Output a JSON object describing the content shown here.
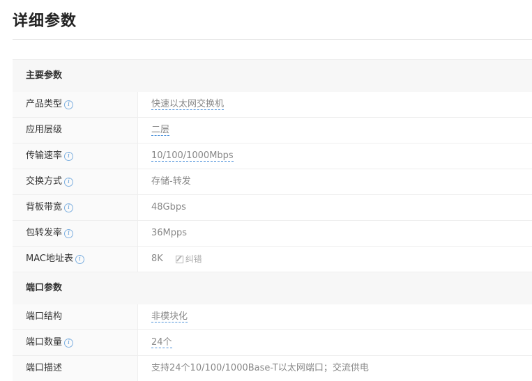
{
  "page_title": "详细参数",
  "sections": [
    {
      "title": "主要参数",
      "rows": [
        {
          "key": "产品类型",
          "value": "快速以太网交换机"
        },
        {
          "key": "应用层级",
          "value": "二层"
        },
        {
          "key": "传输速率",
          "value": "10/100/1000Mbps"
        },
        {
          "key": "交换方式",
          "value": "存储-转发"
        },
        {
          "key": "背板带宽",
          "value": "48Gbps"
        },
        {
          "key": "包转发率",
          "value": "36Mpps"
        },
        {
          "key": "MAC地址表",
          "value": "8K",
          "report_label": "纠错"
        }
      ]
    },
    {
      "title": "端口参数",
      "rows": [
        {
          "key": "端口结构",
          "value": "非模块化"
        },
        {
          "key": "端口数量",
          "value": "24个"
        },
        {
          "key": "端口描述",
          "value": "支持24个10/100/1000Base-T以太网端口；交流供电"
        }
      ]
    }
  ],
  "info_icon_glyph": "i",
  "colors": {
    "link_underline": "#4a90d9",
    "info_icon": "#5a9ad8"
  }
}
